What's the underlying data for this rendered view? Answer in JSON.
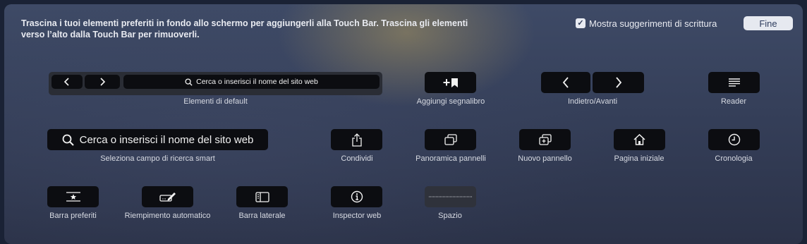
{
  "instructions": {
    "line1": "Trascina i tuoi elementi preferiti in fondo allo schermo per aggiungerli alla Touch Bar. Trascina gli elementi",
    "line2": "verso l’alto dalla Touch Bar per rimuoverli."
  },
  "suggestions": {
    "label": "Mostra suggerimenti di scrittura",
    "checked": true,
    "check_glyph": "✓"
  },
  "done_button": {
    "label": "Fine"
  },
  "row1": {
    "default_set": {
      "search_placeholder": "Cerca o inserisci il nome del sito web",
      "caption": "Elementi di default",
      "icons": [
        "chevron-left-icon",
        "chevron-right-icon",
        "search-icon"
      ]
    },
    "add_bookmark": {
      "caption": "Aggiungi segnalibro",
      "icon": "plus-bookmark-icon",
      "glyph": "+"
    },
    "back_forward": {
      "caption": "Indietro/Avanti",
      "icons": [
        "chevron-left-icon",
        "chevron-right-icon"
      ]
    },
    "reader": {
      "caption": "Reader",
      "icon": "reader-lines-icon"
    }
  },
  "row2": {
    "smart_search": {
      "label": "Cerca o inserisci il nome del sito web",
      "caption": "Seleziona campo di ricerca smart",
      "icon": "search-icon"
    },
    "share": {
      "caption": "Condividi",
      "icon": "share-icon"
    },
    "tab_overview": {
      "caption": "Panoramica pannelli",
      "icon": "tab-overview-icon"
    },
    "new_tab": {
      "caption": "Nuovo pannello",
      "icon": "new-tab-icon"
    },
    "home": {
      "caption": "Pagina iniziale",
      "icon": "home-icon"
    },
    "history": {
      "caption": "Cronologia",
      "icon": "clock-icon"
    }
  },
  "row3": {
    "favorites_bar": {
      "caption": "Barra preferiti",
      "icon": "favorites-bar-icon"
    },
    "autofill": {
      "caption": "Riempimento automatico",
      "icon": "autofill-icon"
    },
    "sidebar": {
      "caption": "Barra laterale",
      "icon": "sidebar-icon"
    },
    "web_inspector": {
      "caption": "Inspector web",
      "icon": "info-icon"
    },
    "space": {
      "caption": "Spazio",
      "icon": "space-dots-icon"
    }
  }
}
